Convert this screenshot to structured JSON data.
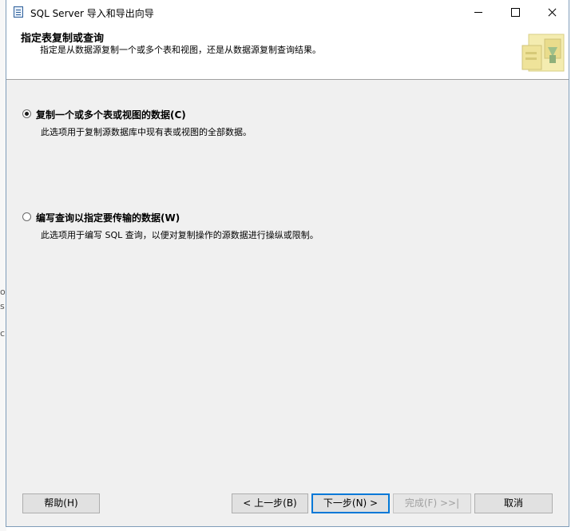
{
  "window": {
    "title": "SQL Server 导入和导出向导"
  },
  "header": {
    "title": "指定表复制或查询",
    "subtitle": "指定是从数据源复制一个或多个表和视图，还是从数据源复制查询结果。"
  },
  "options": [
    {
      "label": "复制一个或多个表或视图的数据(C)",
      "description": "此选项用于复制源数据库中现有表或视图的全部数据。",
      "selected": true
    },
    {
      "label": "编写查询以指定要传输的数据(W)",
      "description": "此选项用于编写 SQL 查询，以便对复制操作的源数据进行操纵或限制。",
      "selected": false
    }
  ],
  "buttons": {
    "help": "帮助(H)",
    "back": "< 上一步(B)",
    "next": "下一步(N) >",
    "finish": "完成(F) >>|",
    "cancel": "取消"
  },
  "colors": {
    "accent": "#0078d7",
    "window_bg": "#f0f0f0",
    "header_bg": "#ffffff"
  }
}
